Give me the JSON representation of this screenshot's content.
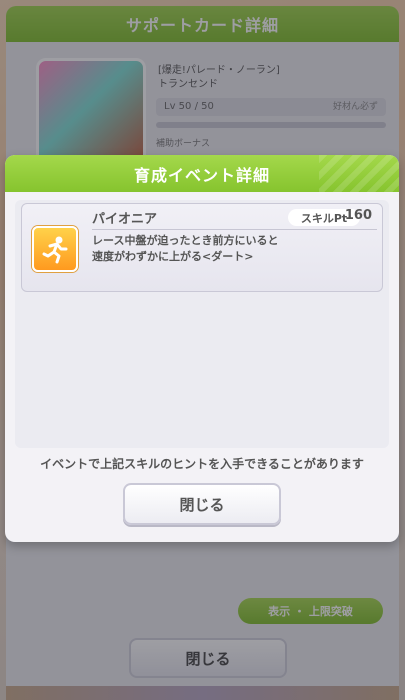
{
  "background": {
    "title": "サポートカード詳細",
    "card_name_line1": "[爆走!パレード・ノーラン]",
    "card_name_line2": "トランセンド",
    "level": "Lv 50 / 50",
    "level_right": "好材ん必ず",
    "sub_label": "補助ボーナス",
    "green_button": "表示 ・ 上限突破",
    "close_button": "閉じる"
  },
  "modal": {
    "title": "育成イベント詳細",
    "skill": {
      "name": "パイオニア",
      "pt_label": "スキルPt",
      "pt_value": "160",
      "description_line1": "レース中盤が迫ったとき前方にいると",
      "description_line2": "速度がわずかに上がる<ダート>",
      "icon": "speed-skill-icon"
    },
    "notice": "イベントで上記スキルのヒントを入手できることがあります",
    "close_button": "閉じる"
  },
  "colors": {
    "header_green": "#86c42e",
    "skill_icon_orange": "#ff9a1f"
  }
}
